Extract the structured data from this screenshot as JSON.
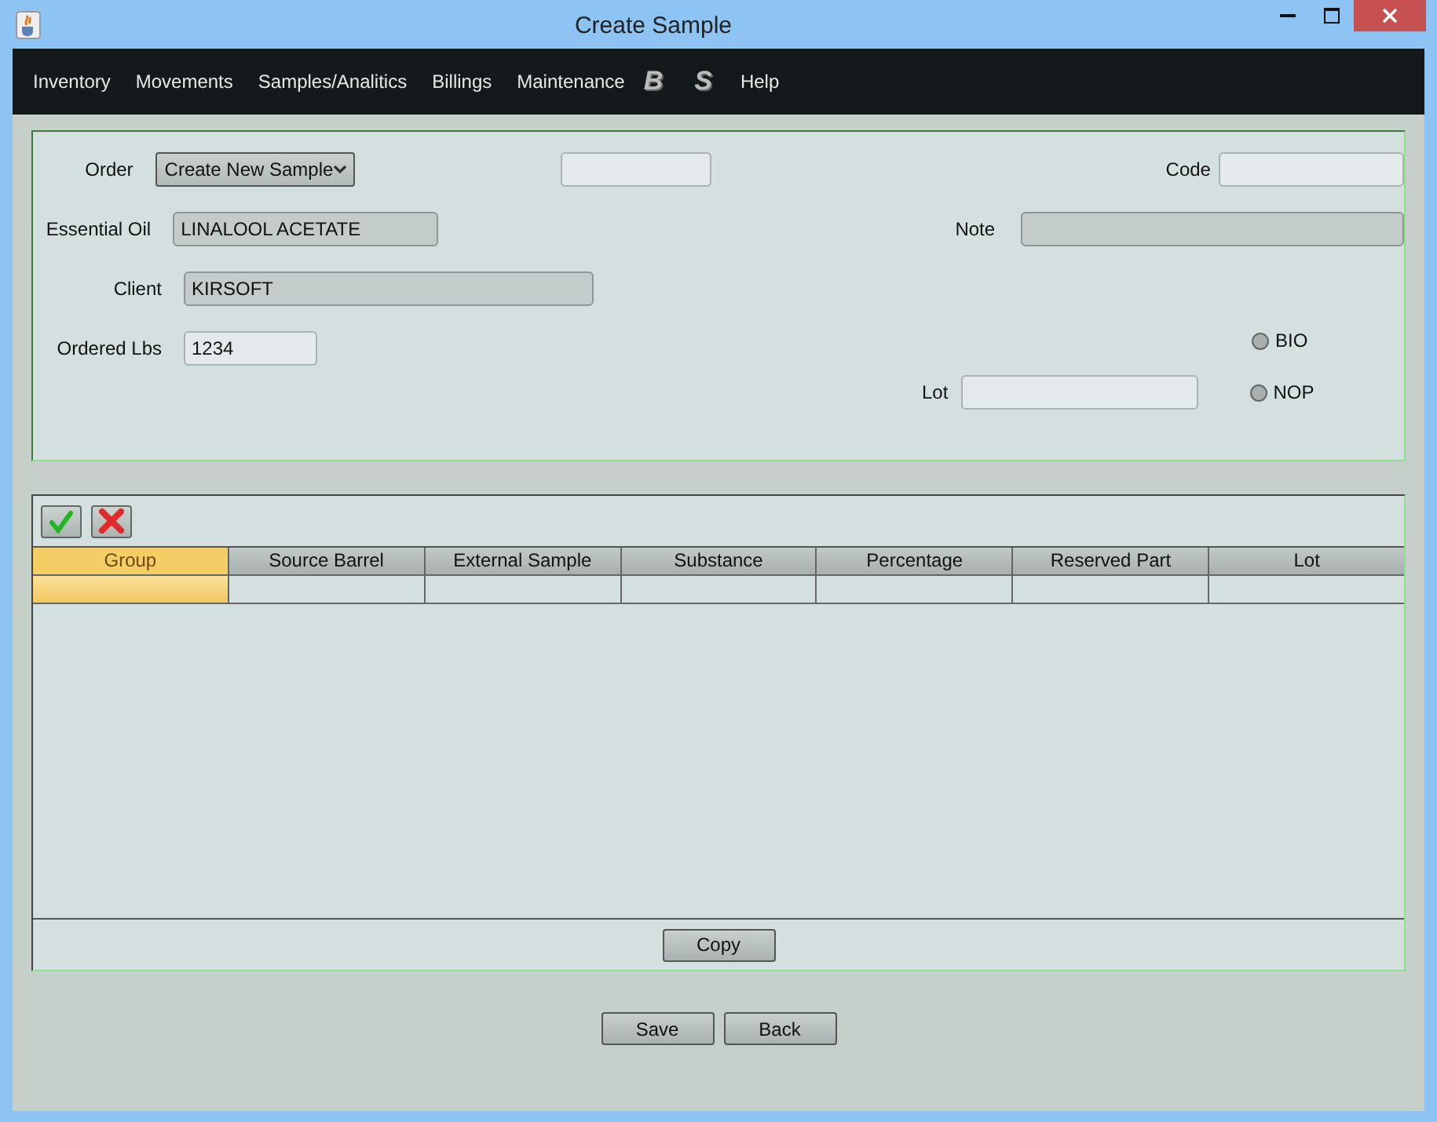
{
  "window": {
    "title": "Create Sample"
  },
  "menu": [
    {
      "label": "Inventory",
      "kind": "text"
    },
    {
      "label": "Movements",
      "kind": "text"
    },
    {
      "label": "Samples/Analitics",
      "kind": "text"
    },
    {
      "label": "Billings",
      "kind": "text"
    },
    {
      "label": "Maintenance",
      "kind": "text"
    },
    {
      "label": "B",
      "kind": "logo"
    },
    {
      "label": "S",
      "kind": "logo"
    },
    {
      "label": "Help",
      "kind": "text"
    }
  ],
  "form": {
    "order": {
      "label": "Order",
      "value": "Create New Sample"
    },
    "field_2": {
      "disabled": false
    },
    "code": {
      "label": "Code",
      "disabled": false
    },
    "essential_oil": {
      "label": "Essential Oil",
      "value": "LINALOOL ACETATE",
      "disabled": true
    },
    "note": {
      "label": "Note",
      "disabled": true
    },
    "client": {
      "label": "Client",
      "value": "KIRSOFT",
      "disabled": true
    },
    "ordered_lbs": {
      "label": "Ordered Lbs",
      "value": "1234",
      "disabled": false
    },
    "lot": {
      "label": "Lot",
      "disabled": false
    },
    "options": [
      {
        "label": "BIO",
        "selected": false
      },
      {
        "label": "NOP",
        "selected": false
      }
    ]
  },
  "table": {
    "columns": [
      {
        "label": "Group",
        "selected": true
      },
      {
        "label": "Source Barrel",
        "selected": false
      },
      {
        "label": "External Sample",
        "selected": false
      },
      {
        "label": "Substance",
        "selected": false
      },
      {
        "label": "Percentage",
        "selected": false
      },
      {
        "label": "Reserved Part",
        "selected": false
      },
      {
        "label": "Lot",
        "selected": false
      }
    ],
    "copy_button": "Copy"
  },
  "buttons": [
    "Save",
    "Back"
  ]
}
